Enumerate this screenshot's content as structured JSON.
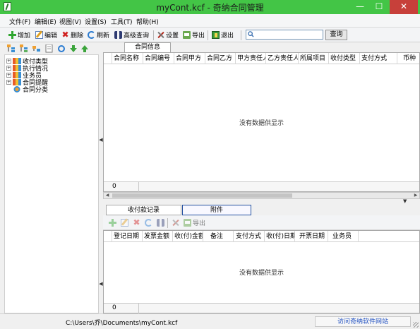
{
  "window": {
    "title": "myCont.kcf - 奇纳合同管理",
    "min_glyph": "—",
    "max_glyph": "☐",
    "close_glyph": "✕"
  },
  "menu": [
    "文件(F)",
    "编辑(E)",
    "视图(V)",
    "设置(S)",
    "工具(T)",
    "帮助(H)"
  ],
  "toolbar": {
    "add": "增加",
    "edit": "编辑",
    "delete": "删除",
    "refresh": "刷新",
    "advanced_search": "高级查询",
    "settings": "设置",
    "export": "导出",
    "exit": "退出",
    "search_placeholder": "",
    "search_button": "查询"
  },
  "tree": {
    "items": [
      {
        "label": "收付类型",
        "expand": "+"
      },
      {
        "label": "执行情况",
        "expand": "+"
      },
      {
        "label": "业务员",
        "expand": "+"
      },
      {
        "label": "合同提醒",
        "expand": "+"
      },
      {
        "label": "合同分类",
        "expand": ""
      }
    ]
  },
  "main_tab": "合同信息",
  "main_grid": {
    "columns": [
      "合同名称",
      "合同编号",
      "合同甲方",
      "合同乙方",
      "甲方责任人",
      "乙方责任人",
      "所属项目",
      "收付类型",
      "支付方式",
      "币种"
    ],
    "empty_message": "没有数据供显示",
    "count": "0"
  },
  "bottom_tabs": [
    "收付款记录",
    "附件"
  ],
  "sub_toolbar": {
    "export": "导出"
  },
  "bottom_grid": {
    "columns": [
      "登记日期",
      "发票金额",
      "收(付)金额",
      "备注",
      "支付方式",
      "收(付)日期",
      "开票日期",
      "业务员"
    ],
    "empty_message": "没有数据供显示",
    "count": "0"
  },
  "status": {
    "path": "C:\\Users\\乔\\Documents\\myCont.kcf",
    "site_link": "访问奇纳软件网站"
  }
}
